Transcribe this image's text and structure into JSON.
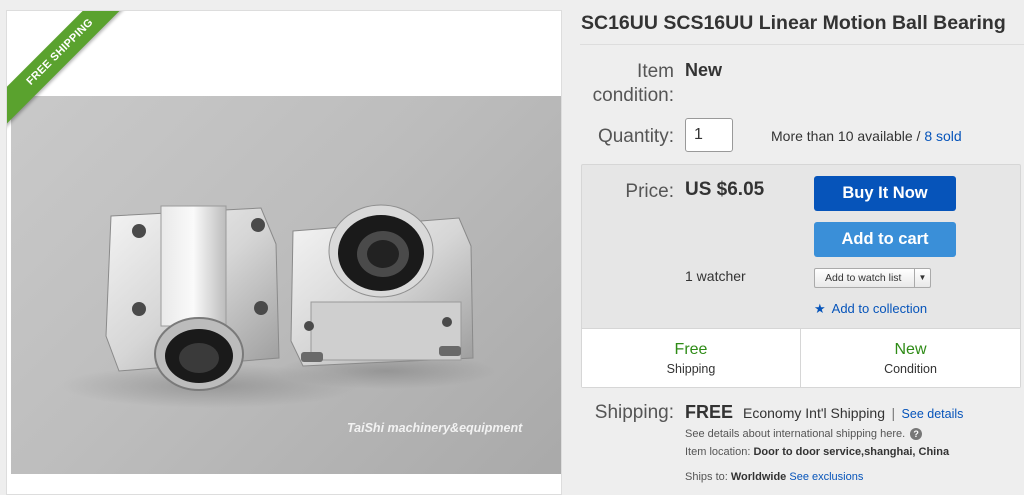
{
  "image": {
    "ribbon": "FREE SHIPPING",
    "watermark": "TaiShi machinery&equipment"
  },
  "listing": {
    "title": "SC16UU SCS16UU Linear Motion Ball Bearing",
    "condition_label_1": "Item",
    "condition_label_2": "condition:",
    "condition_value": "New",
    "quantity_label": "Quantity:",
    "quantity_value": "1",
    "available_text": "More than 10 available",
    "available_sep": " / ",
    "sold_link": "8 sold"
  },
  "buy_box": {
    "price_label": "Price:",
    "price_value": "US $6.05",
    "buy_now": "Buy It Now",
    "add_to_cart": "Add to cart",
    "watchers": "1 watcher",
    "watch_select": "Add to watch list",
    "add_to_collection": "Add to collection",
    "badges": [
      {
        "big": "Free",
        "small": "Shipping"
      },
      {
        "big": "New",
        "small": "Condition"
      }
    ]
  },
  "shipping": {
    "label": "Shipping:",
    "free": "FREE",
    "service": "Economy Int'l Shipping",
    "separator": "|",
    "see_details": "See details",
    "intl_note": "See details about international shipping here.",
    "location_label": "Item location:",
    "location_value": "Door to door service,shanghai, China",
    "ships_to_label": "Ships to:",
    "ships_to_value": "Worldwide",
    "see_exclusions": "See exclusions"
  },
  "colors": {
    "accent_blue": "#0654ba",
    "cart_blue": "#3a8fd8",
    "ribbon_green": "#5aa22e",
    "badge_green": "#2e8b16"
  }
}
